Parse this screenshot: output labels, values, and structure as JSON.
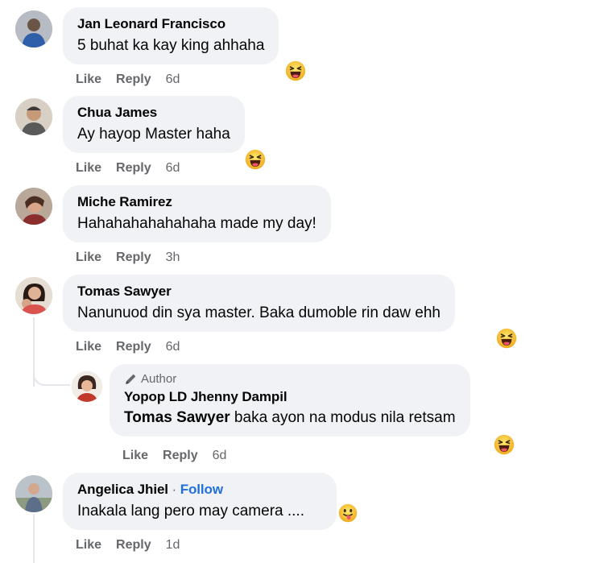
{
  "comments": [
    {
      "name": "Jan Leonard Francisco",
      "text": "5 buhat ka kay king ahhaha",
      "like": "Like",
      "reply": "Reply",
      "time": "6d",
      "reaction": "haha-emoji"
    },
    {
      "name": "Chua James",
      "text": "Ay hayop Master haha",
      "like": "Like",
      "reply": "Reply",
      "time": "6d",
      "reaction": "haha-emoji"
    },
    {
      "name": "Miche Ramirez",
      "text": "Hahahahahahahaha made my day!",
      "like": "Like",
      "reply": "Reply",
      "time": "3h"
    },
    {
      "name": "Tomas Sawyer",
      "text": "Nanunuod din sya master. Baka dumoble rin daw ehh",
      "like": "Like",
      "reply": "Reply",
      "time": "6d",
      "reaction": "haha-emoji"
    },
    {
      "badge": "Author",
      "name": "Yopop LD Jhenny Dampil",
      "mention": "Tomas Sawyer",
      "text": " baka ayon na modus nila retsam",
      "like": "Like",
      "reply": "Reply",
      "time": "6d",
      "reaction": "haha-emoji"
    },
    {
      "name": "Angelica Jhiel",
      "separator": " · ",
      "follow": "Follow",
      "text": "Inakala lang pero may camera ....",
      "like": "Like",
      "reply": "Reply",
      "time": "1d",
      "reaction": "tongue-emoji"
    }
  ],
  "colors": {
    "bubble": "#f0f2f5",
    "meta": "#65676b",
    "link": "#216fdb",
    "emoji": "#f7b125"
  }
}
